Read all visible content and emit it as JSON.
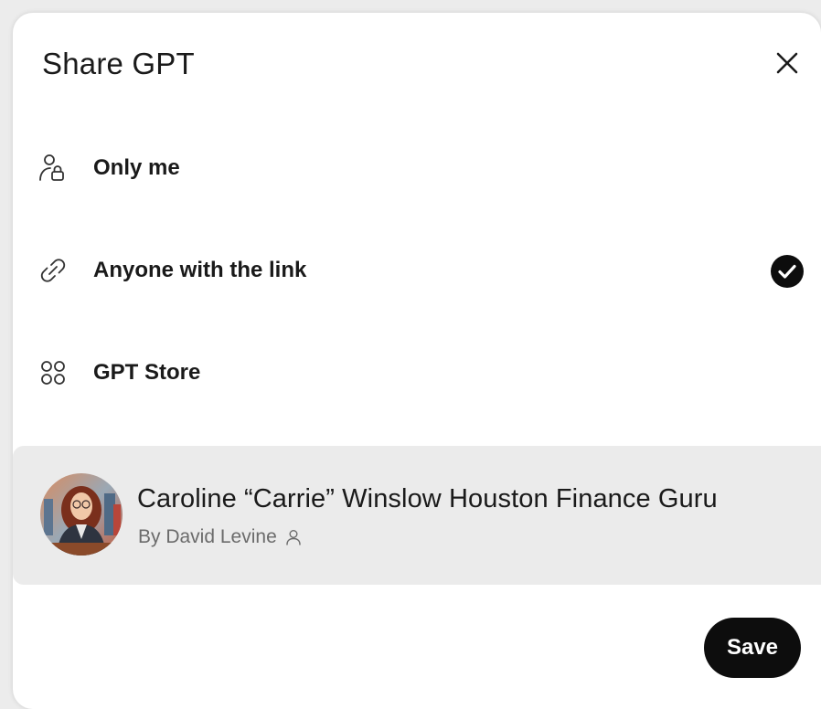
{
  "dialog": {
    "title": "Share GPT",
    "close_icon": "close-icon"
  },
  "options": [
    {
      "label": "Only me",
      "icon": "person-lock-icon",
      "selected": false
    },
    {
      "label": "Anyone with the link",
      "icon": "link-icon",
      "selected": true
    },
    {
      "label": "GPT Store",
      "icon": "apps-grid-icon",
      "selected": false
    }
  ],
  "gpt": {
    "name": "Caroline “Carrie” Winslow Houston Finance Guru",
    "author": "By David Levine",
    "author_icon": "person-icon"
  },
  "footer": {
    "save_label": "Save"
  },
  "colors": {
    "primary_button": "#0d0d0d",
    "card_background": "#ebebeb",
    "check_fill": "#0d0d0d"
  }
}
